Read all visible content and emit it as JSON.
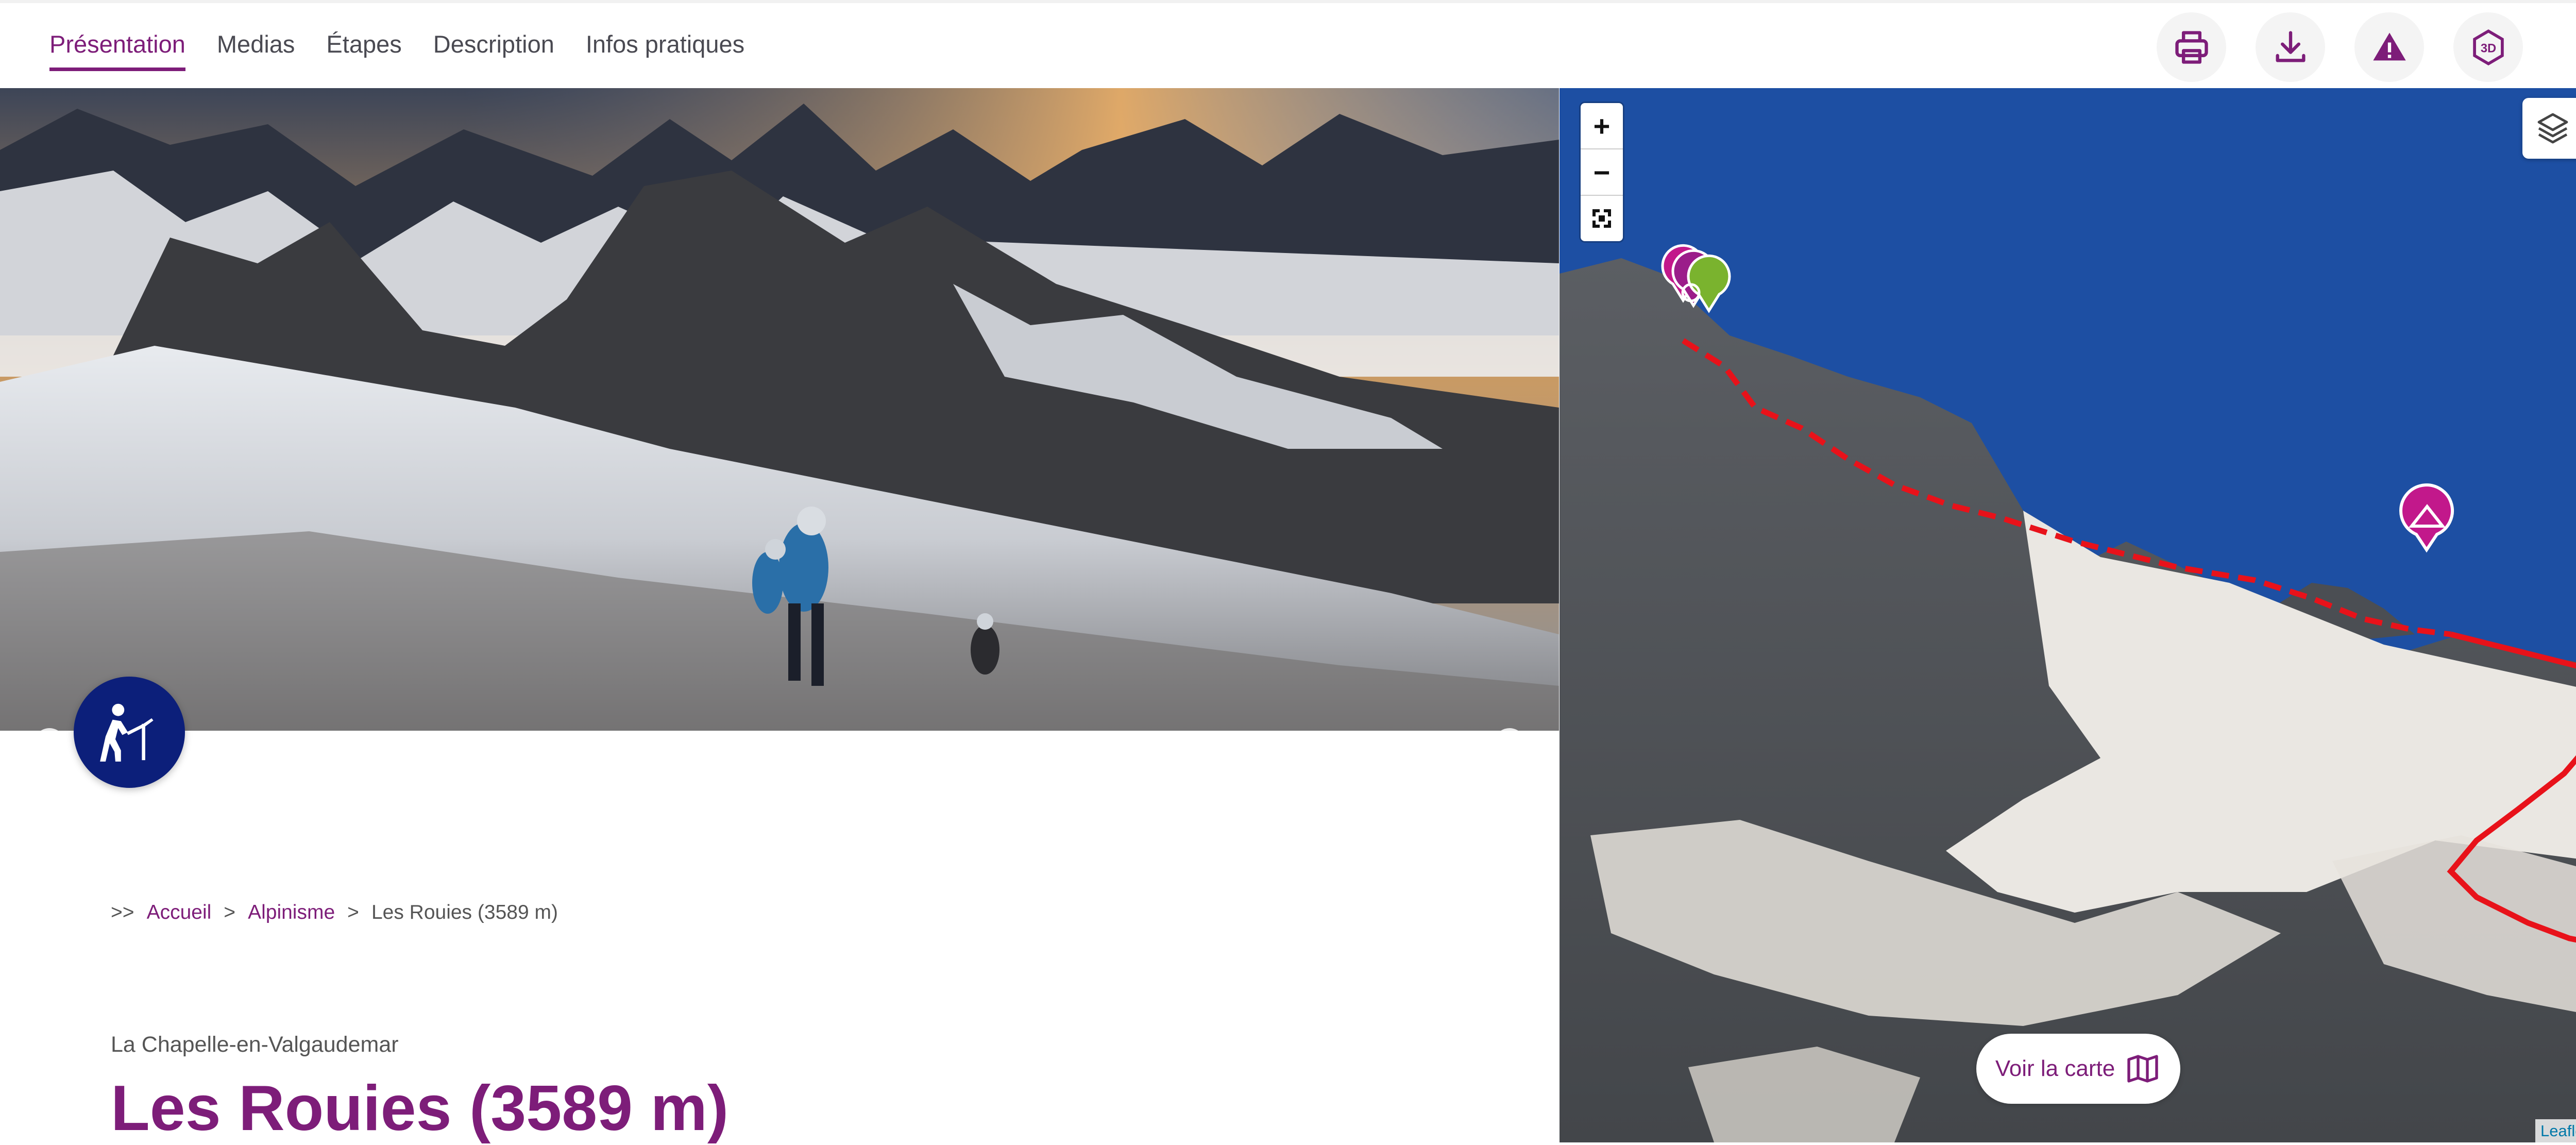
{
  "nav": {
    "tabs": [
      "Présentation",
      "Medias",
      "Étapes",
      "Description",
      "Infos pratiques"
    ],
    "active": "Présentation"
  },
  "toolbar": {
    "icons": [
      "printer-icon",
      "download-icon",
      "warning-icon",
      "3d-icon"
    ],
    "threed_label": "3D"
  },
  "carousel": {
    "slide_count": 3,
    "active_slide": 1,
    "prev_arrow": "‹",
    "next_arrow": "›"
  },
  "breadcrumb": {
    "prefix": ">>",
    "separator": ">",
    "home": "Accueil",
    "category": "Alpinisme",
    "current": "Les Rouies (3589 m)"
  },
  "trek": {
    "town": "La Chapelle-en-Valgaudemar",
    "title": "Les Rouies (3589 m)"
  },
  "map": {
    "zoom_in": "+",
    "zoom_out": "−",
    "view_map_label": "Voir la carte",
    "attribution": "Leaflet",
    "route_color": "#e8121a"
  },
  "colors": {
    "accent": "#7d1d79",
    "badge": "#0c1f7a",
    "flora_marker": "#7ab32e",
    "summit_marker": "#c2188b"
  }
}
